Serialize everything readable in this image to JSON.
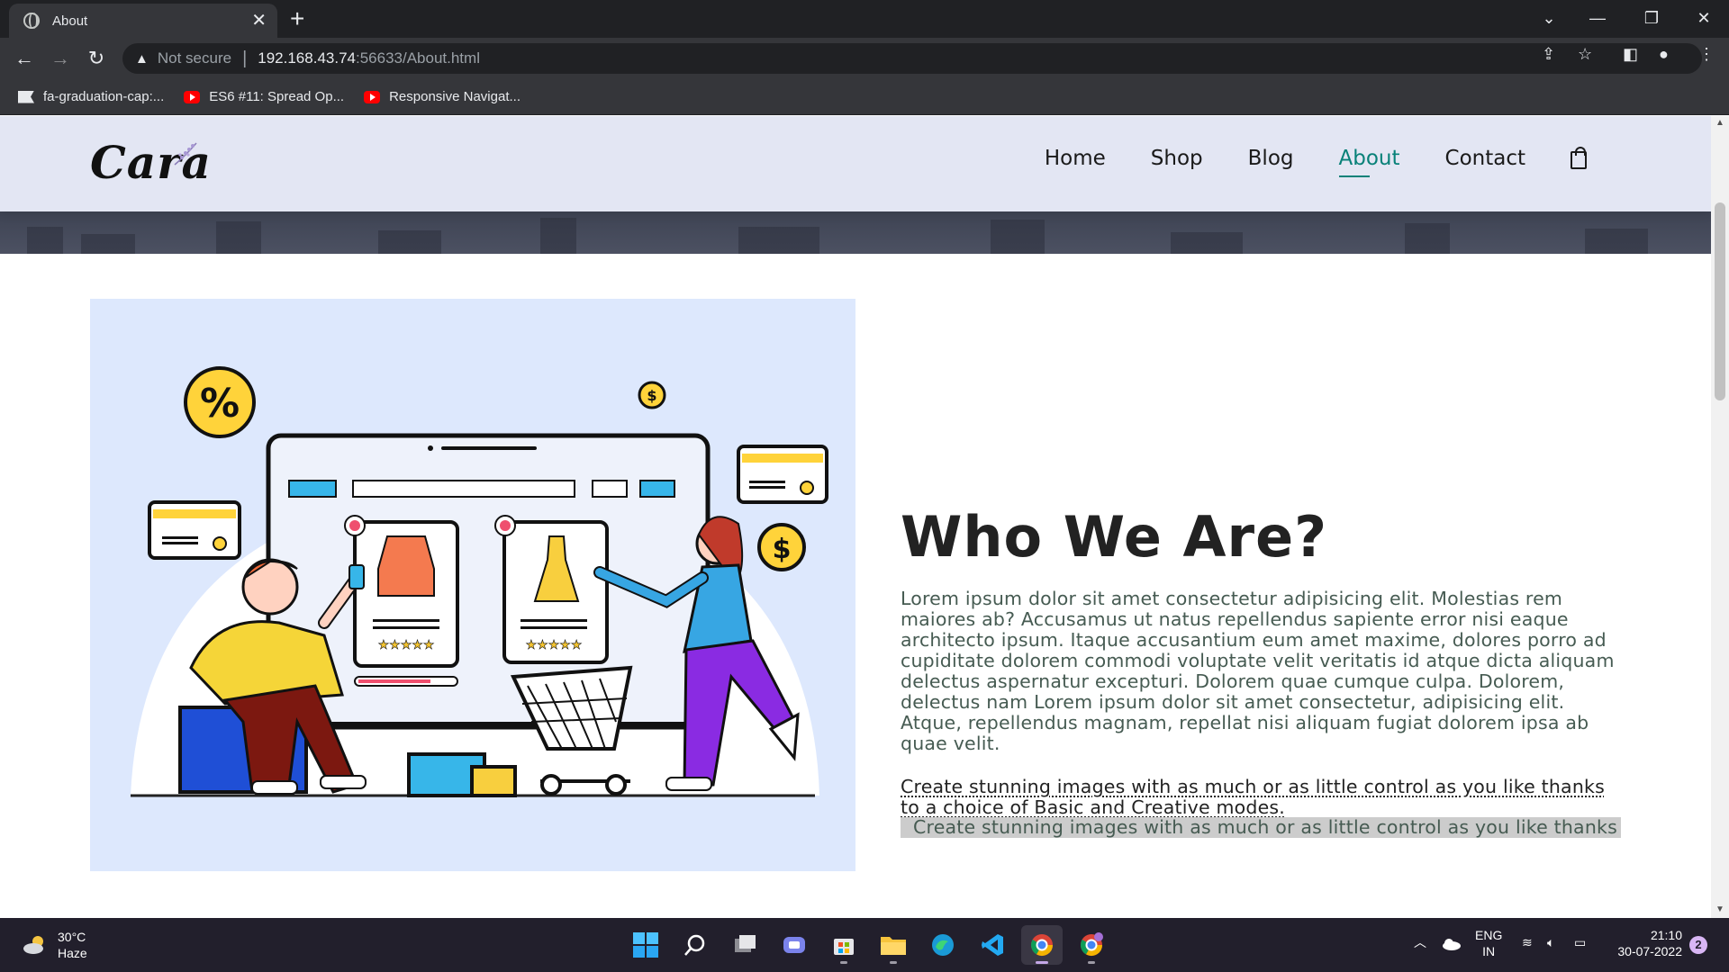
{
  "browser": {
    "tab_title": "About",
    "new_tab_symbol": "+",
    "security_label": "Not secure",
    "url_host": "192.168.43.74",
    "url_rest": ":56633/About.html",
    "bookmarks": [
      {
        "label": "fa-graduation-cap:...",
        "icon": "flag-icon"
      },
      {
        "label": "ES6 #11: Spread Op...",
        "icon": "youtube-icon"
      },
      {
        "label": "Responsive Navigat...",
        "icon": "youtube-icon"
      }
    ]
  },
  "site": {
    "logo": "Cara",
    "nav": [
      "Home",
      "Shop",
      "Blog",
      "About",
      "Contact"
    ],
    "active_nav": "About",
    "accent_color": "#088178",
    "header_bg": "#e3e6f3"
  },
  "about": {
    "title": "Who We Are?",
    "paragraph": "Lorem ipsum dolor sit amet consectetur adipisicing elit. Molestias rem maiores ab? Accusamus ut natus repellendus sapiente error nisi eaque architecto ipsum. Itaque accusantium eum amet maxime, dolores porro ad cupiditate dolorem commodi voluptate velit veritatis id atque dicta aliquam delectus aspernatur excepturi. Dolorem quae cumque culpa. Dolorem, delectus nam Lorem ipsum dolor sit amet consectetur, adipisicing elit. Atque, repellendus magnam, repellat nisi aliquam fugiat dolorem ipsa ab quae velit.",
    "quote": "Create stunning images with as much or as little control as you like thanks to a choice of Basic and Creative modes.",
    "marquee": "Create stunning images with as much or as little control as you like thanks to a choice of Basic and Creative modes."
  },
  "taskbar": {
    "temperature": "30°C",
    "weather": "Haze",
    "language": "ENG",
    "region": "IN",
    "time": "21:10",
    "date": "30-07-2022",
    "notifications": "2"
  }
}
